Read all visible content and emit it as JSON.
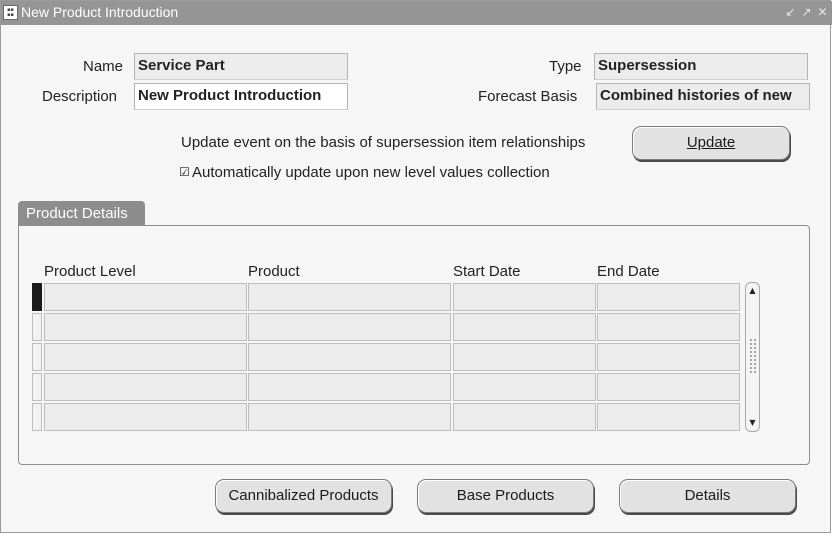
{
  "window": {
    "title": "New Product Introduction",
    "controls": [
      "minimize-icon",
      "maximize-icon",
      "close-icon"
    ]
  },
  "form": {
    "name_label": "Name",
    "name_value": "Service Part",
    "description_label": "Description",
    "description_value": "New Product Introduction",
    "type_label": "Type",
    "type_value": "Supersession",
    "forecast_basis_label": "Forecast Basis",
    "forecast_basis_value": "Combined histories of new",
    "update_text": "Update event on the basis of supersession item relationships",
    "update_button": "Update",
    "auto_update_label": "Automatically update upon new level values collection",
    "auto_update_checked": true
  },
  "tab": {
    "label": "Product Details"
  },
  "table": {
    "columns": [
      "Product Level",
      "Product",
      "Start Date",
      "End Date"
    ],
    "rows": [
      [
        "",
        "",
        "",
        ""
      ],
      [
        "",
        "",
        "",
        ""
      ],
      [
        "",
        "",
        "",
        ""
      ],
      [
        "",
        "",
        "",
        ""
      ],
      [
        "",
        "",
        "",
        ""
      ]
    ]
  },
  "buttons": {
    "cannibalized": "Cannibalized Products",
    "base": "Base Products",
    "details": "Details"
  },
  "colors": {
    "titlebar": "#959595",
    "tab": "#8d8d8d",
    "background": "#f6f6f6",
    "readonly_field": "#ececec"
  }
}
